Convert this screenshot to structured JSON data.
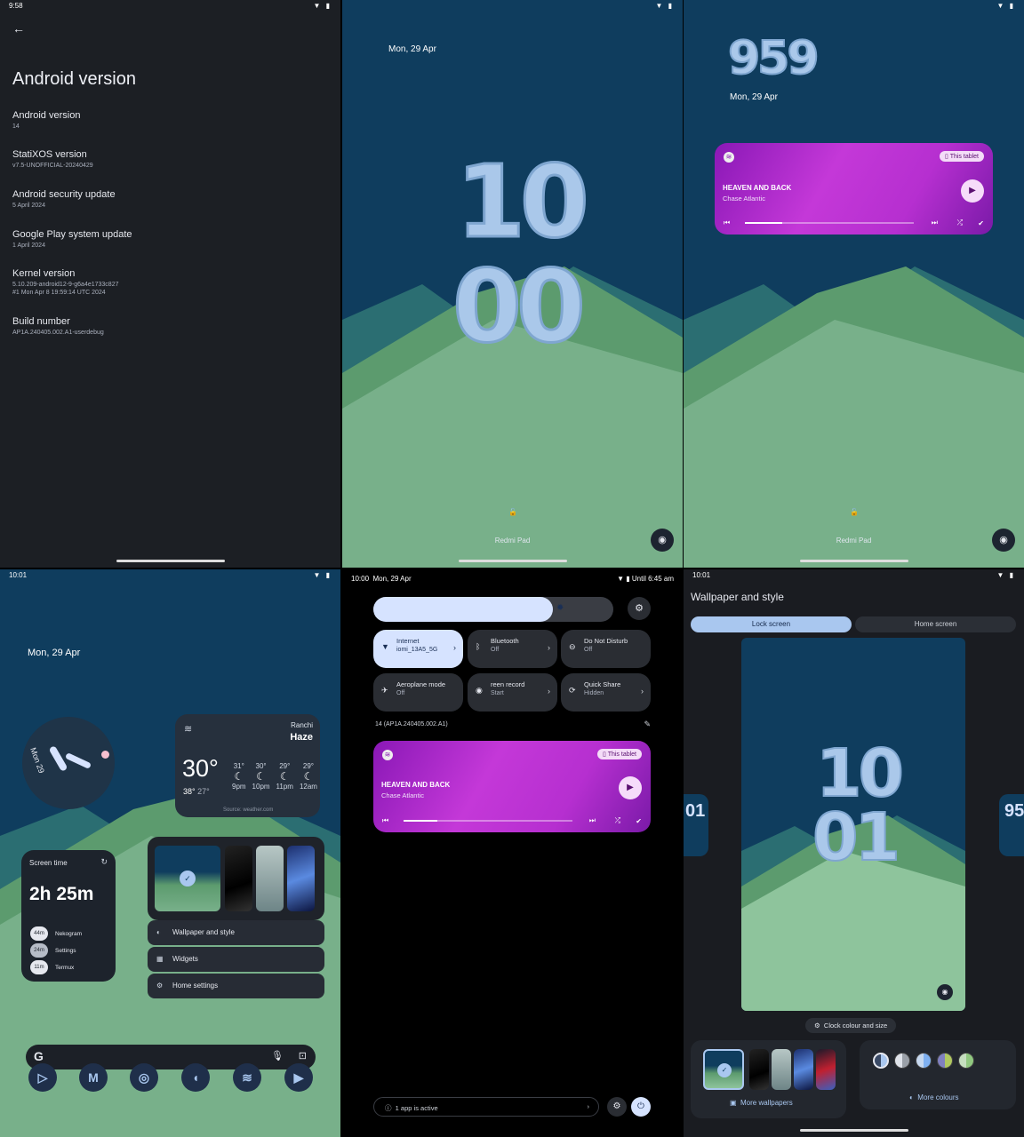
{
  "panel1": {
    "status_time": "9:58",
    "page_title": "Android version",
    "items": [
      {
        "title": "Android version",
        "value": "14"
      },
      {
        "title": "StatiXOS version",
        "value": "v7.5-UNOFFICIAL-20240429"
      },
      {
        "title": "Android security update",
        "value": "5 April 2024"
      },
      {
        "title": "Google Play system update",
        "value": "1 April 2024"
      },
      {
        "title": "Kernel version",
        "value": "5.10.209-android12-9-g6a4e1733c827",
        "value2": "#1 Mon Apr 8 19:59:14 UTC 2024"
      },
      {
        "title": "Build number",
        "value": "AP1A.240405.002.A1-userdebug"
      }
    ]
  },
  "panel2": {
    "date": "Mon, 29 Apr",
    "clock_hour": "10",
    "clock_min": "00",
    "device_name": "Redmi Pad"
  },
  "panel3": {
    "clock": "959",
    "date": "Mon, 29 Apr",
    "device_name": "Redmi Pad",
    "media": {
      "song": "HEAVEN AND BACK",
      "artist": "Chase Atlantic",
      "output_chip": "This tablet",
      "progress": 0.22
    }
  },
  "panel4": {
    "status_time": "10:01",
    "date": "Mon, 29 Apr",
    "analog_date": "Mon 29",
    "weather": {
      "city": "Ranchi",
      "condition": "Haze",
      "temp": "30°",
      "high": "38°",
      "low": "27°",
      "source": "Source: weather.com",
      "forecast": [
        {
          "t": "31°",
          "h": "9pm"
        },
        {
          "t": "30°",
          "h": "10pm"
        },
        {
          "t": "29°",
          "h": "11pm"
        },
        {
          "t": "29°",
          "h": "12am"
        }
      ]
    },
    "screen_time": {
      "title": "Screen time",
      "total": "2h 25m",
      "apps": [
        {
          "time": "44m",
          "name": "Nekogram"
        },
        {
          "time": "24m",
          "name": "Settings"
        },
        {
          "time": "11m",
          "name": "Termux"
        }
      ]
    },
    "menu": {
      "wallpaper": "Wallpaper and style",
      "widgets": "Widgets",
      "home": "Home settings"
    },
    "dock_icons": [
      "play-store-icon",
      "gmail-icon",
      "chrome-icon",
      "nekogram-icon",
      "spotify-icon",
      "youtube-icon"
    ]
  },
  "panel5": {
    "status_time": "10:00",
    "status_date": "Mon, 29 Apr",
    "status_right": "Until 6:45 am",
    "tiles": [
      {
        "label": "Internet",
        "state": "iomi_13A5_5G"
      },
      {
        "label": "Bluetooth",
        "state": "Off"
      },
      {
        "label": "Do Not Disturb",
        "state": "Off"
      },
      {
        "label": "Aeroplane mode",
        "state": "Off"
      },
      {
        "label": "reen record",
        "state": "Start"
      },
      {
        "label": "Quick Share",
        "state": "Hidden"
      }
    ],
    "build": "14 (AP1A.240405.002.A1)",
    "media": {
      "song": "HEAVEN AND BACK",
      "artist": "Chase Atlantic",
      "output_chip": "This tablet",
      "progress": 0.2
    },
    "footer": "1 app is active",
    "brightness": 0.9
  },
  "panel6": {
    "status_time": "10:01",
    "title": "Wallpaper and style",
    "tabs": [
      "Lock screen",
      "Home screen"
    ],
    "clock_hour": "10",
    "clock_min": "01",
    "clock_button": "Clock colour and size",
    "more_wallpapers": "More wallpapers",
    "more_colours": "More colours"
  },
  "colors": {
    "accent": "#aac8ea",
    "media": "#b62fd0",
    "tile_on": "#d6e3ff"
  }
}
